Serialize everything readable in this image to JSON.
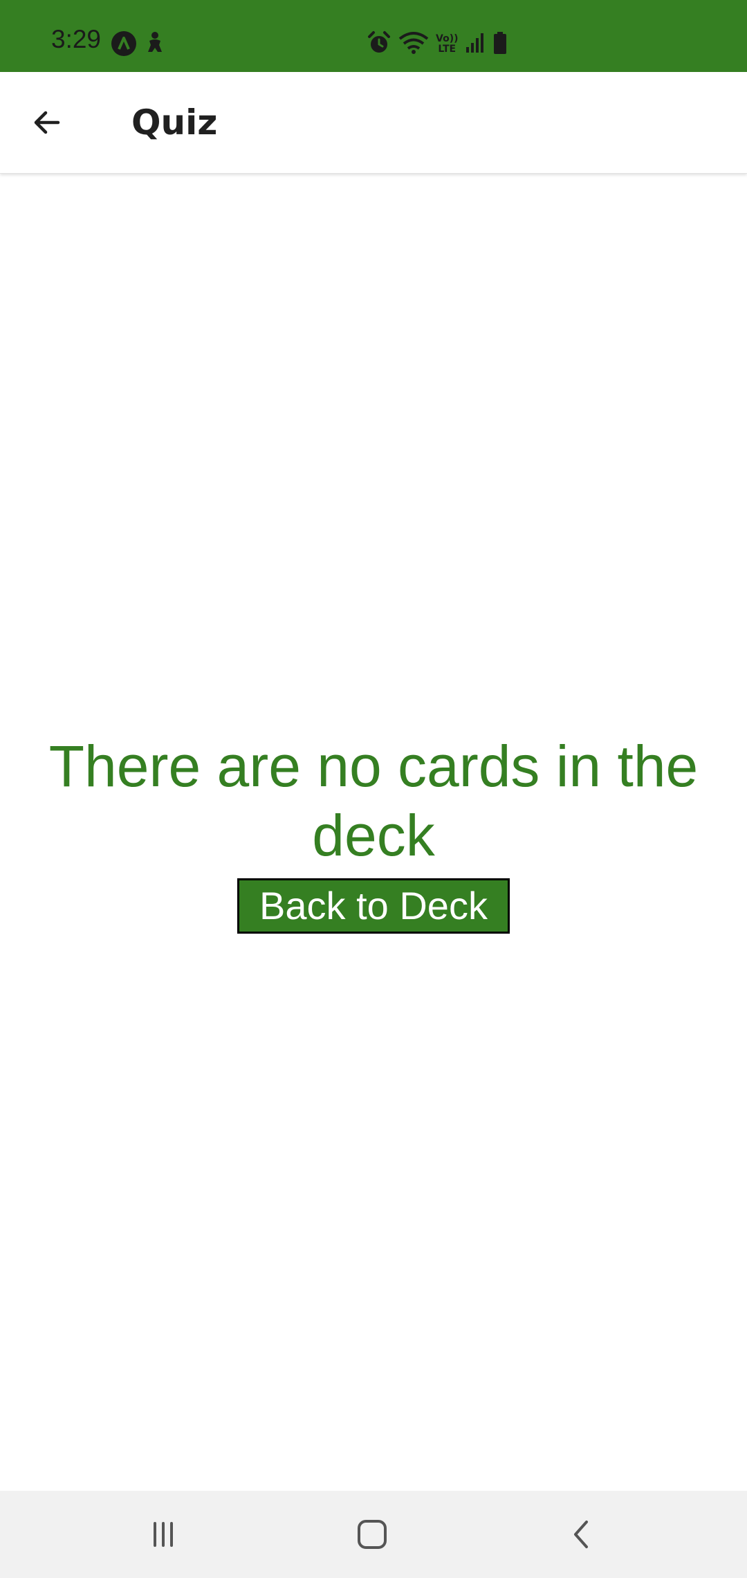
{
  "status_bar": {
    "time": "3:29",
    "background": "#357f22",
    "left_icons": [
      "app-notification-icon",
      "accessibility-icon"
    ],
    "right_icons": [
      "alarm-icon",
      "wifi-icon",
      "volte-icon",
      "signal-icon",
      "battery-icon"
    ],
    "volte_text_top": "Vo))",
    "volte_text_bottom": "LTE"
  },
  "app_bar": {
    "title": "Quiz",
    "back_icon": "arrow-back-icon"
  },
  "main": {
    "message": "There are no cards in the deck",
    "button_label": "Back to Deck",
    "accent_color": "#357f22"
  },
  "nav_bar": {
    "items": [
      "recent-apps-icon",
      "home-icon",
      "back-icon"
    ]
  }
}
